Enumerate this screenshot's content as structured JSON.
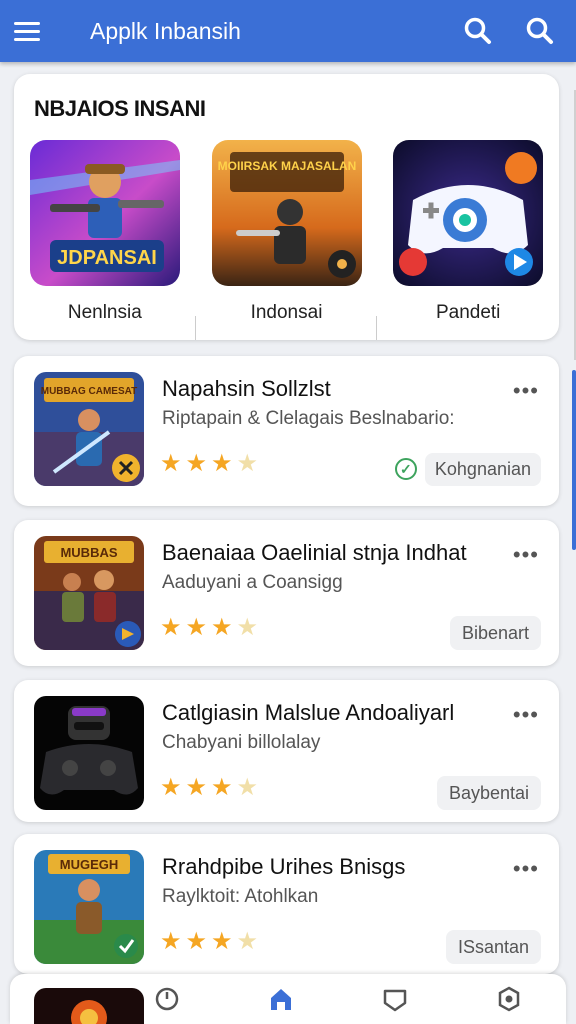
{
  "app": {
    "title": "Applk Inbansih"
  },
  "featured": {
    "title": "NBJAIOS INSANI",
    "tiles": [
      {
        "label": "Nenlnsia",
        "art_text": "JDPANSAI"
      },
      {
        "label": "Indonsai",
        "art_text": "MOIIRSAK MAJASALAN"
      },
      {
        "label": "Pandeti",
        "art_text": ""
      }
    ]
  },
  "cards": [
    {
      "title": "Napahsin Sollzlst",
      "subtitle": "Riptapain & Clelagais Beslnabario:",
      "rating": 3.5,
      "action": "Kohgnanian",
      "verified": true,
      "art_text": "MUBBAG CAMESAT"
    },
    {
      "title": "Baenaiaa Oaelinial stnja Indhat",
      "subtitle": "Aaduyani a Coansigg",
      "rating": 3.5,
      "action": "Bibenart",
      "verified": false,
      "art_text": "MUBBAS"
    },
    {
      "title": "Catlgiasin Malslue Andoaliyarl",
      "subtitle": "Chabyani billolalay",
      "rating": 3.5,
      "action": "Baybentai",
      "verified": false,
      "art_text": ""
    },
    {
      "title": "Rrahdpibe Urihes Bnisgs",
      "subtitle": "Raylktoit: Atohlkan",
      "rating": 3.5,
      "action": "ISsantan",
      "verified": false,
      "art_text": "MUGEGH"
    }
  ],
  "icons": {
    "menu": "menu-icon",
    "search": "search-icon",
    "more": "more-dots-icon",
    "nav": [
      "recent-icon",
      "home-icon",
      "favorites-icon",
      "settings-icon"
    ]
  },
  "colors": {
    "appbar": "#3b6fd6",
    "star": "#f5a623",
    "verified": "#3da35d"
  }
}
